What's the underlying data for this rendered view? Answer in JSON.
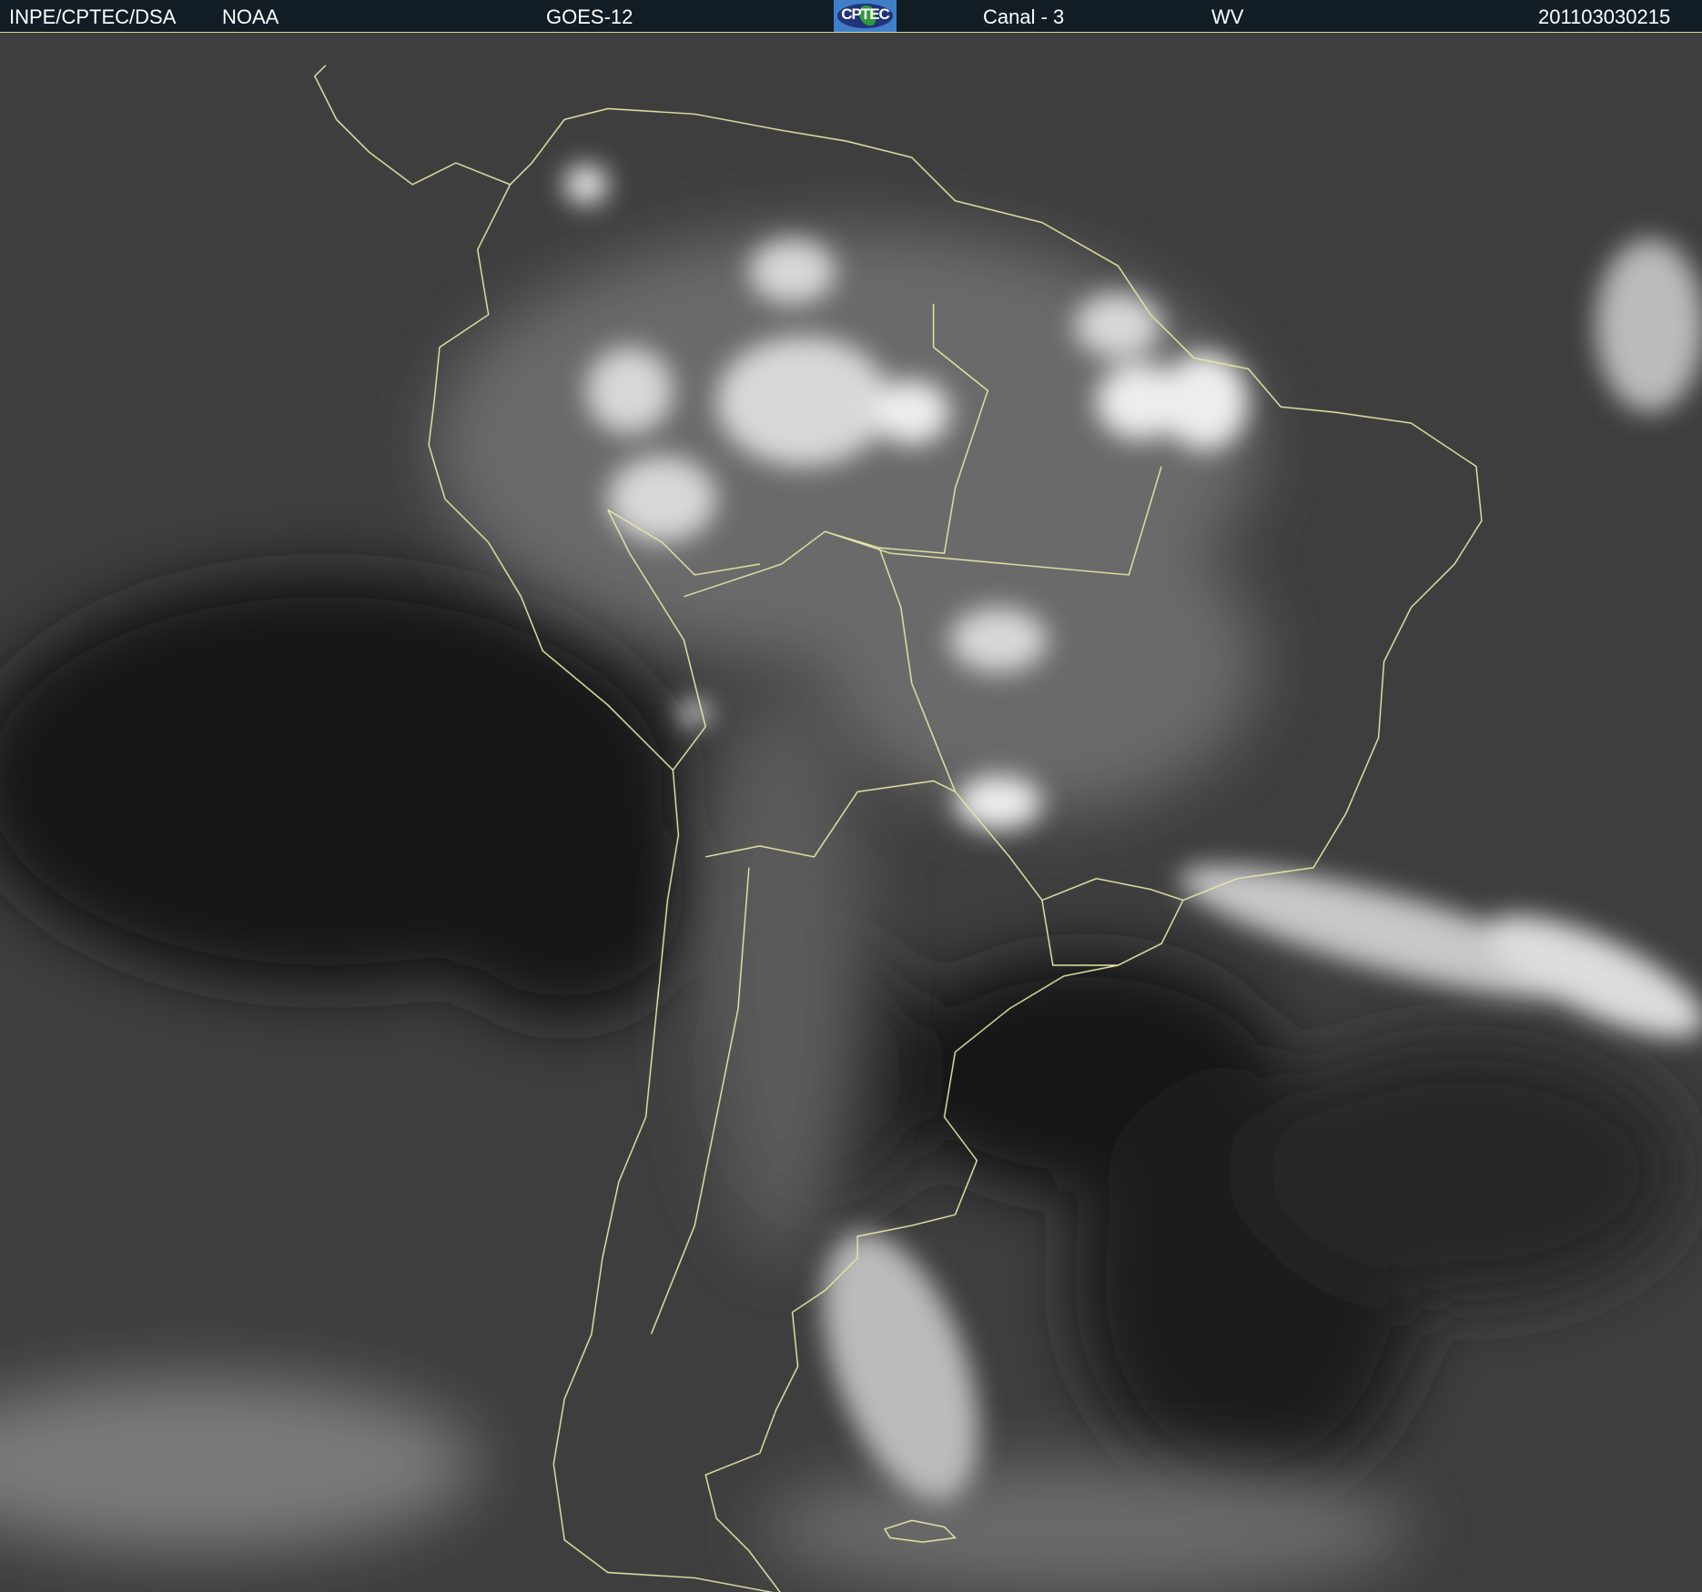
{
  "header": {
    "institution": "INPE/CPTEC/DSA",
    "agency": "NOAA",
    "satellite": "GOES-12",
    "logo_text": "CPTEC",
    "channel": "Canal - 3",
    "band": "WV",
    "timestamp": "201103030215"
  },
  "colors": {
    "header_bg": "#121c25",
    "coastline": "#e8e8a8",
    "logo_blue": "#3f7fc9"
  }
}
